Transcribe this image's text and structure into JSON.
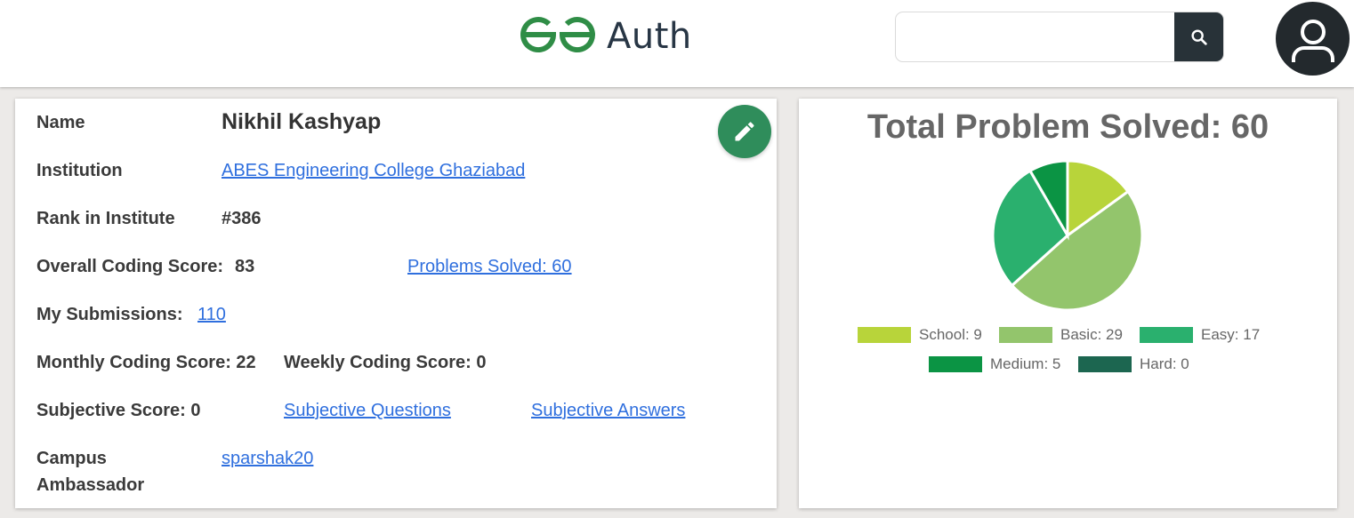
{
  "header": {
    "logo_text": "Auth",
    "search": {
      "value": "",
      "placeholder": ""
    }
  },
  "profile": {
    "name_label": "Name",
    "name": "Nikhil Kashyap",
    "institution_label": "Institution",
    "institution": "ABES Engineering College Ghaziabad",
    "rank_label": "Rank in Institute",
    "rank": "#386",
    "overall_label": "Overall Coding Score:",
    "overall": "83",
    "problems_solved_link": "Problems Solved: 60",
    "submissions_label": "My Submissions:",
    "submissions": "110",
    "monthly": "Monthly Coding Score: 22",
    "weekly": "Weekly Coding Score: 0",
    "subjective": "Subjective Score: 0",
    "subjective_questions": "Subjective Questions",
    "subjective_answers": "Subjective Answers",
    "campus_label_line1": "Campus",
    "campus_label_line2": "Ambassador",
    "campus": "sparshak20"
  },
  "colors": {
    "accent": "#2f8d5b",
    "link": "#2f6fde",
    "school": "#b8d43a",
    "basic": "#93c56c",
    "easy": "#2ab06e",
    "medium": "#0b9444",
    "hard": "#1c6650"
  },
  "chart_data": {
    "type": "pie",
    "title": "Total Problem Solved: 60",
    "categories": [
      "School",
      "Basic",
      "Easy",
      "Medium",
      "Hard"
    ],
    "values": [
      9,
      29,
      17,
      5,
      0
    ],
    "legend": [
      "School: 9",
      "Basic: 29",
      "Easy: 17",
      "Medium: 5",
      "Hard: 0"
    ],
    "colors": [
      "#b8d43a",
      "#93c56c",
      "#2ab06e",
      "#0b9444",
      "#1c6650"
    ],
    "legend_position": "bottom"
  }
}
